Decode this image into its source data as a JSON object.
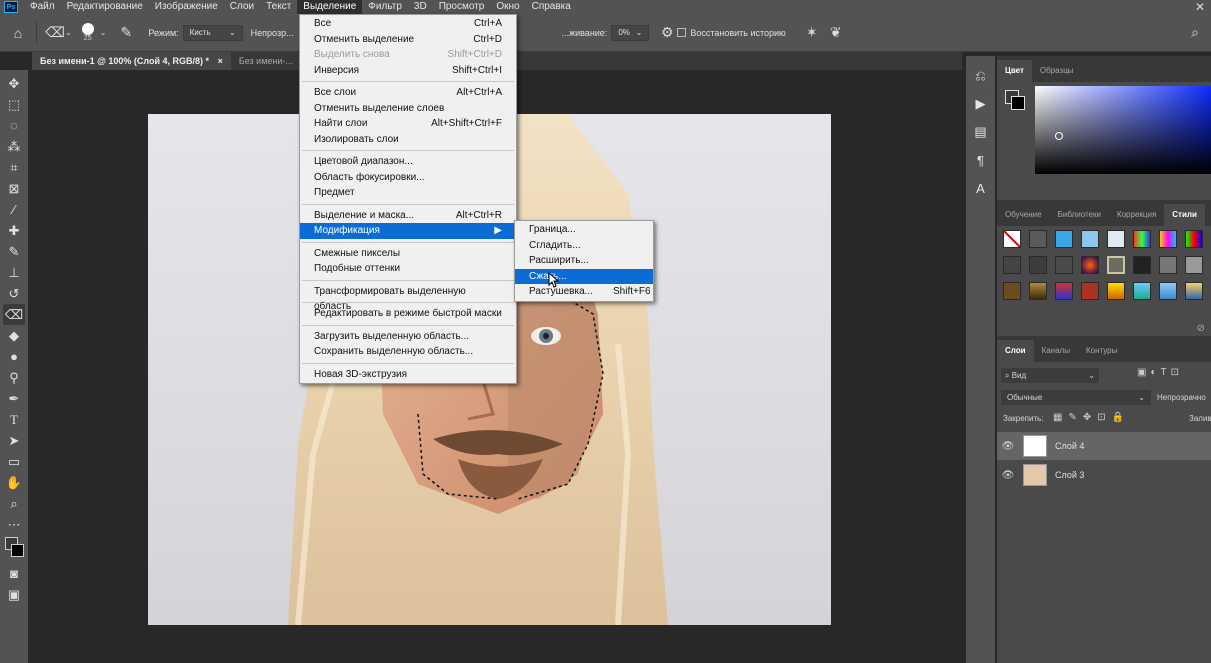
{
  "menubar": {
    "logo": "Ps",
    "items": [
      "Файл",
      "Редактирование",
      "Изображение",
      "Слои",
      "Текст",
      "Выделение",
      "Фильтр",
      "3D",
      "Просмотр",
      "Окно",
      "Справка"
    ],
    "close": "✕"
  },
  "optbar": {
    "brush_size": "25",
    "mode_label": "Режим:",
    "mode_value": "Кисть",
    "opacity_label": "Непрозр...",
    "smoothing_label": "...живание:",
    "smoothing_value": "0%",
    "restore_history": "Восстановить историю"
  },
  "tabs": [
    "Без имени-1 @ 100% (Слой 4, RGB/8) *",
    "Без имени-..."
  ],
  "tab_close": "×",
  "select_menu": {
    "groups": [
      [
        {
          "label": "Все",
          "shortcut": "Ctrl+A"
        },
        {
          "label": "Отменить выделение",
          "shortcut": "Ctrl+D"
        },
        {
          "label": "Выделить снова",
          "shortcut": "Shift+Ctrl+D",
          "disabled": true
        },
        {
          "label": "Инверсия",
          "shortcut": "Shift+Ctrl+I"
        }
      ],
      [
        {
          "label": "Все слои",
          "shortcut": "Alt+Ctrl+A"
        },
        {
          "label": "Отменить выделение слоев",
          "shortcut": ""
        },
        {
          "label": "Найти слои",
          "shortcut": "Alt+Shift+Ctrl+F"
        },
        {
          "label": "Изолировать слои",
          "shortcut": ""
        }
      ],
      [
        {
          "label": "Цветовой диапазон...",
          "shortcut": ""
        },
        {
          "label": "Область фокусировки...",
          "shortcut": ""
        },
        {
          "label": "Предмет",
          "shortcut": ""
        }
      ],
      [
        {
          "label": "Выделение и маска...",
          "shortcut": "Alt+Ctrl+R"
        },
        {
          "label": "Модификация",
          "shortcut": "",
          "highlighted": true,
          "submenu": true
        }
      ],
      [
        {
          "label": "Смежные пикселы",
          "shortcut": ""
        },
        {
          "label": "Подобные оттенки",
          "shortcut": ""
        }
      ],
      [
        {
          "label": "Трансформировать выделенную область",
          "shortcut": ""
        }
      ],
      [
        {
          "label": "Редактировать в режиме быстрой маски",
          "shortcut": ""
        }
      ],
      [
        {
          "label": "Загрузить выделенную область...",
          "shortcut": ""
        },
        {
          "label": "Сохранить выделенную область...",
          "shortcut": ""
        }
      ],
      [
        {
          "label": "Новая 3D-экструзия",
          "shortcut": ""
        }
      ]
    ]
  },
  "modify_submenu": [
    {
      "label": "Граница...",
      "shortcut": ""
    },
    {
      "label": "Сгладить...",
      "shortcut": ""
    },
    {
      "label": "Расширить...",
      "shortcut": ""
    },
    {
      "label": "Сжать...",
      "shortcut": "",
      "highlighted": true
    },
    {
      "label": "Растушевка...",
      "shortcut": "Shift+F6"
    }
  ],
  "color_panel": {
    "tabs": [
      "Цвет",
      "Образцы"
    ]
  },
  "styles_panel": {
    "tabs": [
      "Обучение",
      "Библиотеки",
      "Коррекция",
      "Стили"
    ]
  },
  "layers_panel": {
    "tabs": [
      "Слои",
      "Каналы",
      "Контуры"
    ],
    "filter_label": "Вид",
    "blend_mode": "Обычные",
    "opacity_label": "Непрозрачно",
    "lock_label": "Закрепить:",
    "fill_label": "Залив",
    "layers": [
      {
        "name": "Слой 4",
        "selected": true
      },
      {
        "name": "Слой 3",
        "selected": false
      }
    ]
  },
  "colors": {
    "menu_highlight": "#0a6dd6",
    "ui_dark": "#535353",
    "panel_bg": "#4a4a4a",
    "canvas_bg": "#282828"
  }
}
